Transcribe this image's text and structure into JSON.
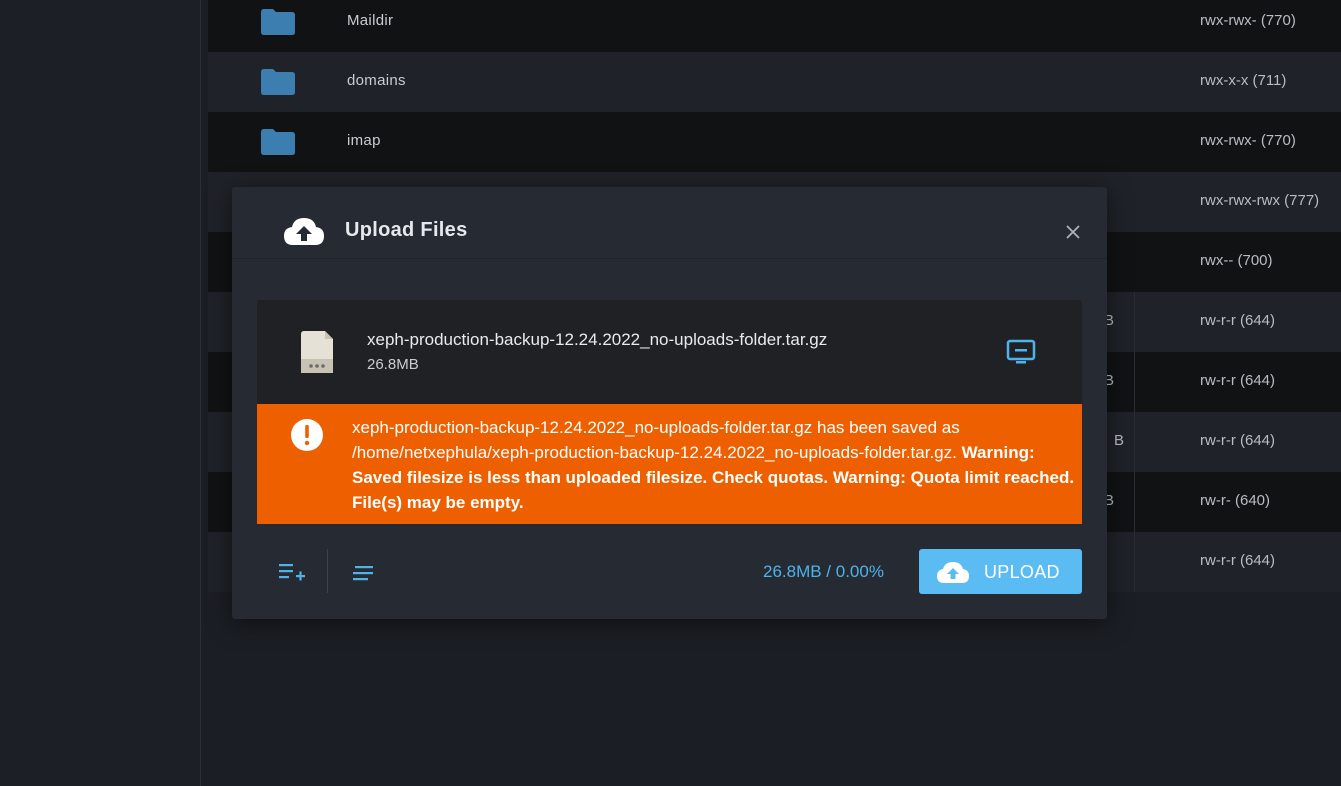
{
  "files": [
    {
      "name": "Maildir",
      "size": "",
      "perm": "rwx-rwx- (770)"
    },
    {
      "name": "domains",
      "size": "",
      "perm": "rwx-x-x (711)"
    },
    {
      "name": "imap",
      "size": "",
      "perm": "rwx-rwx- (770)"
    },
    {
      "name": "",
      "size": "",
      "perm": "rwx-rwx-rwx (777)"
    },
    {
      "name": "",
      "size": "",
      "perm": "rwx-- (700)"
    },
    {
      "name": "",
      "size": "B",
      "perm": "rw-r-r (644)"
    },
    {
      "name": "",
      "size": "B",
      "perm": "rw-r-r (644)"
    },
    {
      "name": "",
      "size": "B",
      "perm": "rw-r-r (644)"
    },
    {
      "name": "",
      "size": "B",
      "perm": "rw-r- (640)"
    },
    {
      "name": "",
      "size": "",
      "perm": "rw-r-r (644)"
    }
  ],
  "modal": {
    "title": "Upload Files",
    "file": {
      "name": "xeph-production-backup-12.24.2022_no-uploads-folder.tar.gz",
      "size": "26.8MB"
    },
    "warning": {
      "message": "xeph-production-backup-12.24.2022_no-uploads-folder.tar.gz has been saved as /home/netxephula/xeph-production-backup-12.24.2022_no-uploads-folder.tar.gz.",
      "bold": "Warning: Saved filesize is less than uploaded filesize. Check quotas. Warning: Quota limit reached. File(s) may be empty."
    },
    "progress": "26.8MB / 0.00%",
    "upload_label": "UPLOAD"
  },
  "colors": {
    "warning": "#ee5f00",
    "accent": "#5bbcf3",
    "folder": "#3d7eb0"
  },
  "icons": [
    "folder-icon",
    "cloud-upload-icon",
    "close-icon",
    "document-icon",
    "monitor-icon",
    "alert-icon",
    "add-list-icon",
    "lines-icon"
  ]
}
